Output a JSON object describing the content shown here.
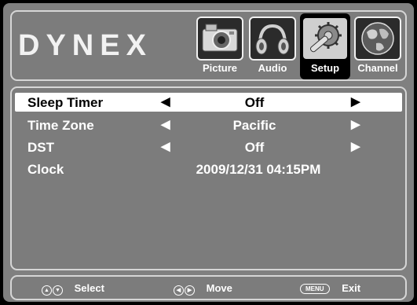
{
  "brand": {
    "logo_text": "DYNEX"
  },
  "tabs": [
    {
      "label": "Picture",
      "icon": "camera-icon",
      "selected": false
    },
    {
      "label": "Audio",
      "icon": "headphones-icon",
      "selected": false
    },
    {
      "label": "Setup",
      "icon": "tools-icon",
      "selected": true
    },
    {
      "label": "Channel",
      "icon": "globe-icon",
      "selected": false
    }
  ],
  "setup": {
    "rows": [
      {
        "name": "Sleep Timer",
        "value": "Off",
        "selected": true,
        "left_arrow": "◀",
        "right_arrow": "▶"
      },
      {
        "name": "Time Zone",
        "value": "Pacific",
        "selected": false,
        "left_arrow": "◀",
        "right_arrow": "▶"
      },
      {
        "name": "DST",
        "value": "Off",
        "selected": false,
        "left_arrow": "◀",
        "right_arrow": "▶"
      },
      {
        "name": "Clock",
        "value": "2009/12/31 04:15PM",
        "selected": false
      }
    ]
  },
  "footer": {
    "select_label": "Select",
    "move_label": "Move",
    "menu_key": "MENU",
    "exit_label": "Exit"
  },
  "colors": {
    "panel_bg": "#808080",
    "border": "#d6d6d6",
    "selected_row_bg": "#ffffff"
  }
}
